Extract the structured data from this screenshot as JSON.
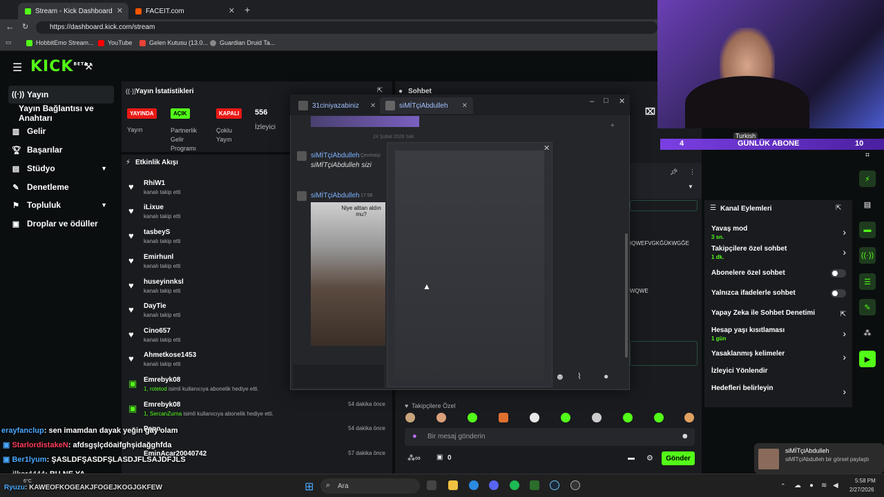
{
  "browser": {
    "tabs": [
      {
        "label": "Stream - Kick Dashboard",
        "active": true
      },
      {
        "label": "FACEIT.com",
        "active": false
      }
    ],
    "url": "https://dashboard.kick.com/stream",
    "bookmarks": [
      "HobbitEmo Stream...",
      "YouTube",
      "Gelen Kutusu (13.0...",
      "Guardian Druid Ta..."
    ]
  },
  "kick": {
    "logo": "KICK",
    "logo_tag": "BETA"
  },
  "sidebar": {
    "items": [
      {
        "label": "Yayın",
        "icon": "broadcast-icon"
      },
      {
        "label": "Yayın Bağlantısı ve Anahtarı",
        "icon": ""
      },
      {
        "label": "Gelir",
        "icon": "chart-icon"
      },
      {
        "label": "Başarılar",
        "icon": "trophy-icon"
      },
      {
        "label": "Stüdyo",
        "icon": "studio-icon"
      },
      {
        "label": "Denetleme",
        "icon": "wrench-icon"
      },
      {
        "label": "Topluluk",
        "icon": "community-icon"
      },
      {
        "label": "Droplar ve ödüller",
        "icon": "gift-icon"
      }
    ]
  },
  "stats": {
    "title": "Yayın İstatistikleri",
    "badges": [
      {
        "badge": "YAYINDA",
        "label": "Yayın",
        "color": "#e91916"
      },
      {
        "badge": "AÇIK",
        "label": "Partnerlik Gelir Programı",
        "color": "#53fc18"
      },
      {
        "badge": "KAPALI",
        "label": "Çoklu Yayın",
        "color": "#e91916"
      }
    ],
    "viewers": "556",
    "viewers_label": "İzleyici"
  },
  "activity": {
    "title": "Etkinlik Akışı",
    "items": [
      {
        "name": "RhiW1",
        "sub": "kanalı takip etti",
        "time": ""
      },
      {
        "name": "iLixue",
        "sub": "kanalı takip etti",
        "time": ""
      },
      {
        "name": "tasbeyS",
        "sub": "kanalı takip etti",
        "time": ""
      },
      {
        "name": "Emirhunl",
        "sub": "kanalı takip etti",
        "time": ""
      },
      {
        "name": "huseyinnksl",
        "sub": "kanalı takip etti",
        "time": ""
      },
      {
        "name": "DayTie",
        "sub": "kanalı takip etti",
        "time": ""
      },
      {
        "name": "Cino657",
        "sub": "kanalı takip etti",
        "time": ""
      },
      {
        "name": "Ahmetkose1453",
        "sub": "kanalı takip etti",
        "time": ""
      },
      {
        "name": "Emrebyk08",
        "sub_highlight": "1, rotetod",
        "sub": "isimli kullanıcıya abonelik hediye etti.",
        "time": ""
      },
      {
        "name": "Emrebyk08",
        "sub_highlight": "1, SercanZurna",
        "sub": "isimli kullanıcıya abonelik hediye etti.",
        "time": "54 dakika önce"
      },
      {
        "name": "Pepo",
        "sub": "",
        "time": "54 dakika önce"
      },
      {
        "name": "EminAcar20040742",
        "sub": "",
        "time": "57 dakika önce"
      }
    ]
  },
  "popup": {
    "tabs": [
      "31ciniyazabiniz",
      "siMİTçiAbdulleh"
    ],
    "date": "24 Şubat 2026 Salı",
    "messages": [
      {
        "user": "siMİTçiAbdulleh",
        "text": "siMİTçiAbdulleh sizi",
        "time": "Çevrimiçi"
      },
      {
        "user": "siMİTçiAbdulleh",
        "text": "",
        "time": "17:58"
      }
    ],
    "image_caption": "Niye alttan aldın mu?"
  },
  "chat": {
    "title": "Sohbet",
    "fragment1": "IQWEFVGKĞÜKWGĞE",
    "fragment2": "WQWE",
    "followers_only": "Takipçilere Özel",
    "placeholder": "Bir mesaj gönderin",
    "points": "0",
    "send": "Gönder"
  },
  "kanal": {
    "title": "Kanal Eylemleri",
    "items": [
      {
        "label": "Yavaş mod",
        "sub": "3 sn.",
        "control": "arrow"
      },
      {
        "label": "Takipçilere özel sohbet",
        "sub": "1 dk.",
        "control": "arrow"
      },
      {
        "label": "Abonelere özel sohbet",
        "sub": "",
        "control": "toggle"
      },
      {
        "label": "Yalnızca ifadelerle sohbet",
        "sub": "",
        "control": "toggle"
      },
      {
        "label": "Yapay Zeka ile Sohbet Denetimi",
        "sub": "",
        "control": "external"
      },
      {
        "label": "Hesap yaşı kısıtlaması",
        "sub": "1 gün",
        "control": "arrow"
      },
      {
        "label": "Yasaklanmış kelimeler",
        "sub": "",
        "control": "arrow"
      },
      {
        "label": "İzleyici Yönlendir",
        "sub": "",
        "control": "none"
      },
      {
        "label": "Hedefleri belirleyin",
        "sub": "",
        "control": "arrow"
      }
    ]
  },
  "overlay": {
    "goal_left": "4",
    "goal_label": "GÜNLÜK ABONE",
    "goal_right": "10",
    "lang": "Turkish",
    "chat_lines": [
      {
        "user": "erayfanclup",
        "text": ": sen imamdan dayak yeğin gay olam",
        "color": "#4aa8ff"
      },
      {
        "user": "StarlordistakeN",
        "text": ": afdsgşlçdöaifghşidağghfda",
        "color": "#ff3b5c"
      },
      {
        "user": "Ber1lyum",
        "text": ": ŞASLDFŞASDFŞLASDJFLSAJDFJLS",
        "color": "#4aa8ff"
      },
      {
        "user": "ilker4444",
        "text": ": BU NE YA",
        "color": "#cccccc"
      },
      {
        "user": "Ryuzu",
        "text": ": KAWEOFKOGEAKJFOGEJKOGJGKFEW",
        "color": "#4aa8ff"
      }
    ],
    "temp": "6°C"
  },
  "notification": {
    "user": "siMİTçiAbdulleh",
    "text": "siMİTçiAbdulleh bir görsel paylaştı"
  },
  "taskbar": {
    "search": "Ara",
    "time": "5:58 PM",
    "date": "2/27/2026"
  }
}
